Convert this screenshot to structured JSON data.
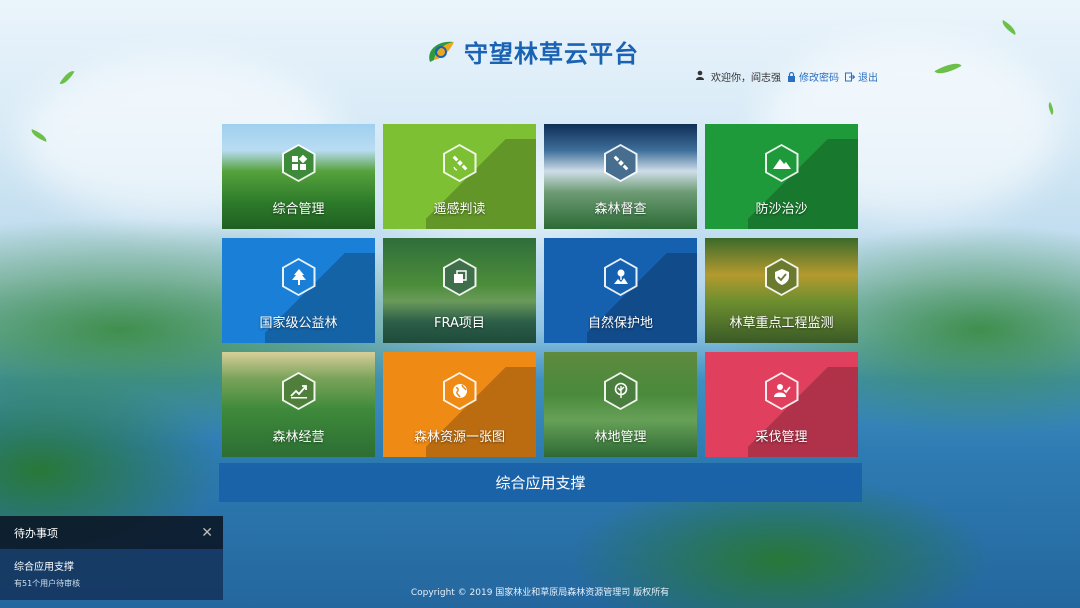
{
  "header": {
    "title": "守望林草云平台",
    "user": {
      "greeting": "欢迎你，阎志强",
      "change_password": "修改密码",
      "logout": "退出"
    }
  },
  "tiles": [
    {
      "label": "综合管理",
      "icon": "grid-icon"
    },
    {
      "label": "遥感判读",
      "icon": "satellite-icon"
    },
    {
      "label": "森林督查",
      "icon": "satellite-icon"
    },
    {
      "label": "防沙治沙",
      "icon": "dune-icon"
    },
    {
      "label": "国家级公益林",
      "icon": "tree-icon"
    },
    {
      "label": "FRA项目",
      "icon": "copy-icon"
    },
    {
      "label": "自然保护地",
      "icon": "reserve-icon"
    },
    {
      "label": "林草重点工程监测",
      "icon": "shield-check-icon"
    },
    {
      "label": "森林经营",
      "icon": "chart-up-icon"
    },
    {
      "label": "森林资源一张图",
      "icon": "globe-icon"
    },
    {
      "label": "林地管理",
      "icon": "round-tree-icon"
    },
    {
      "label": "采伐管理",
      "icon": "user-check-icon"
    }
  ],
  "support_bar": {
    "label": "综合应用支撑"
  },
  "todo": {
    "title": "待办事项",
    "item": {
      "title": "综合应用支撑",
      "desc": "有51个用户待审核"
    }
  },
  "footer": {
    "copyright": "Copyright © 2019 国家林业和草原局森林资源管理司 版权所有"
  },
  "colors": {
    "brand_blue": "#1a62b3",
    "lime": "#7ec034",
    "green": "#1f9a3a",
    "blue": "#1a7fd6",
    "navy": "#1660b0",
    "orange": "#ef8a14",
    "pink": "#e0405e"
  }
}
